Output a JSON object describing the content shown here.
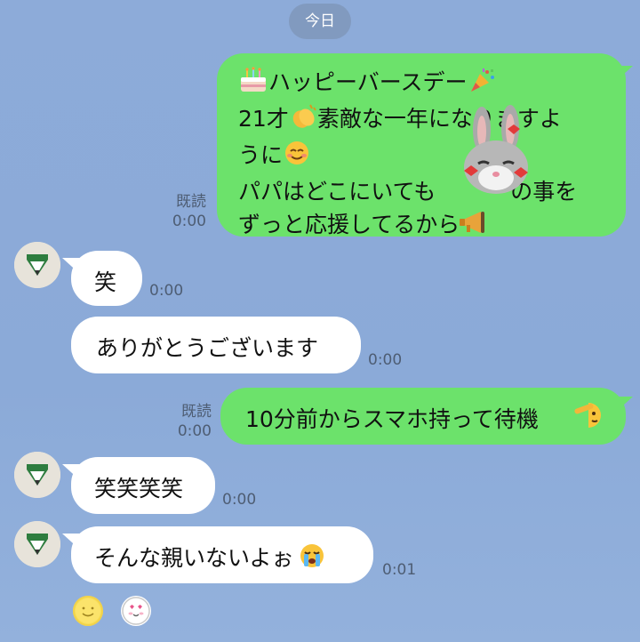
{
  "date_separator": "今日",
  "messages": [
    {
      "direction": "outgoing",
      "lines": [
        "ハッピーバースデー",
        "21才",
        "素敵な一年になりますよ",
        "うに",
        "パパはどこにいても",
        "の事を",
        "ずっと応援してるから"
      ],
      "read_label": "既読",
      "time": "0:00",
      "emojis": [
        "cake-icon",
        "party-popper-icon",
        "clapping-hands-icon",
        "smiling-face-icon",
        "rabbit-sticker-icon",
        "megaphone-icon"
      ]
    },
    {
      "direction": "incoming",
      "text": "笑",
      "time": "0:00"
    },
    {
      "direction": "incoming",
      "text": "ありがとうございます",
      "time": "0:00"
    },
    {
      "direction": "outgoing",
      "text": "10分前からスマホ持って待機",
      "read_label": "既読",
      "time": "0:00",
      "emojis": [
        "saluting-face-icon"
      ]
    },
    {
      "direction": "incoming",
      "text": "笑笑笑笑",
      "time": "0:00"
    },
    {
      "direction": "incoming",
      "text": "そんな親いないよぉ",
      "time": "0:01",
      "emojis": [
        "crying-face-icon"
      ]
    }
  ],
  "reactions": [
    "smile-reaction-icon",
    "heart-eyes-reaction-icon"
  ],
  "colors": {
    "background": "#8CABD8",
    "outgoing_bubble": "#6CE26B",
    "incoming_bubble": "#FFFFFF"
  }
}
